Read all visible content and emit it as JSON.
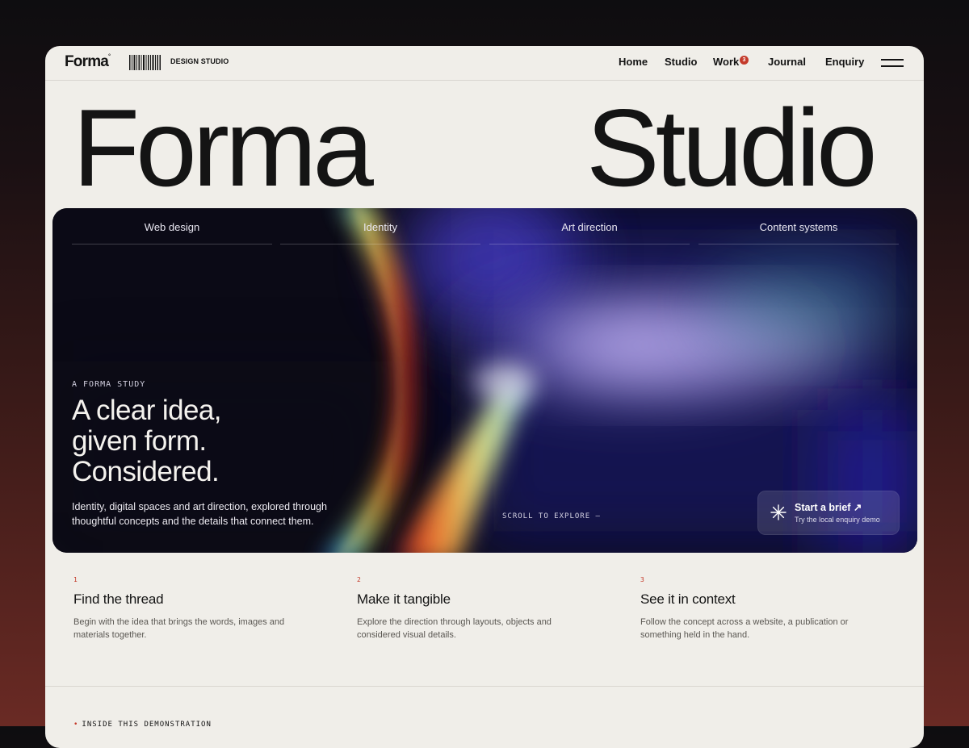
{
  "brand": {
    "logo": "Forma",
    "logo_mark": "°",
    "tagline": "DESIGN STUDIO"
  },
  "nav": {
    "items": [
      "Home",
      "Studio",
      "Work",
      "Journal",
      "Enquiry"
    ],
    "work_badge": "3"
  },
  "hero": {
    "word_left": "Forma",
    "word_right": "Studio"
  },
  "services": {
    "tabs": [
      "Web design",
      "Identity",
      "Art direction",
      "Content systems"
    ]
  },
  "feature": {
    "eyebrow": "A FORMA STUDY",
    "headline_lines": [
      "A clear idea,",
      "given form.",
      "Considered."
    ],
    "lead": "Identity, digital spaces and art direction, explored through thoughtful concepts and the details that connect them.",
    "scroll_cue": "SCROLL TO EXPLORE —",
    "cta": {
      "title": "Start a brief ↗",
      "subtitle": "Try the local enquiry demo",
      "icon": "asterisk-icon"
    }
  },
  "steps": [
    {
      "num": "1",
      "title": "Find the thread",
      "body": "Begin with the idea that brings the words, images and materials together."
    },
    {
      "num": "2",
      "title": "Make it tangible",
      "body": "Explore the direction through layouts, objects and considered visual details."
    },
    {
      "num": "3",
      "title": "See it in context",
      "body": "Follow the concept across a website, a publication or something held in the hand."
    }
  ],
  "footer": {
    "section_label": "INSIDE THIS DEMONSTRATION"
  },
  "colors": {
    "accent": "#c43a2a",
    "page": "#f0eee9",
    "ink": "#141414"
  }
}
